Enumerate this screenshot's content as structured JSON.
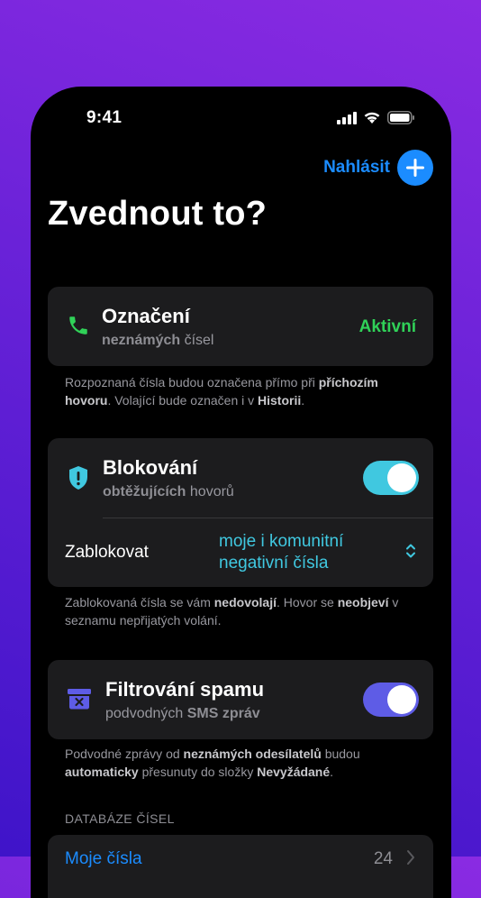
{
  "status": {
    "time": "9:41"
  },
  "header": {
    "report_label": "Nahlásit"
  },
  "title": "Zvednout to?",
  "labeling": {
    "title": "Označení",
    "sub_bold": "neznámých",
    "sub_rest": " čísel",
    "status": "Aktivní",
    "note": [
      {
        "t": "Rozpoznaná čísla budou označena přímo při ",
        "b": false
      },
      {
        "t": "příchozím hovoru",
        "b": true
      },
      {
        "t": ". Volající bude označen i v ",
        "b": false
      },
      {
        "t": "Historii",
        "b": true
      },
      {
        "t": ".",
        "b": false
      }
    ]
  },
  "blocking": {
    "title": "Blokování",
    "sub_bold": "obtěžujících",
    "sub_rest": " hovorů",
    "toggle_on": true,
    "block_label": "Zablokovat",
    "block_value_line1": "moje i komunitní",
    "block_value_line2": "negativní čísla",
    "note": [
      {
        "t": "Zablokovaná čísla se vám ",
        "b": false
      },
      {
        "t": "nedovolají",
        "b": true
      },
      {
        "t": ". Hovor se ",
        "b": false
      },
      {
        "t": "neobjeví",
        "b": true
      },
      {
        "t": " v seznamu nepřijatých volání.",
        "b": false
      }
    ]
  },
  "spam": {
    "title": "Filtrování spamu",
    "sub_rest": "podvodných ",
    "sub_bold": "SMS zpráv",
    "toggle_on": true,
    "note": [
      {
        "t": "Podvodné zprávy od ",
        "b": false
      },
      {
        "t": "neznámých odesílatelů",
        "b": true
      },
      {
        "t": " budou ",
        "b": false
      },
      {
        "t": "automaticky",
        "b": true
      },
      {
        "t": " přesunuty do složky ",
        "b": false
      },
      {
        "t": "Nevyžádané",
        "b": true
      },
      {
        "t": ".",
        "b": false
      }
    ]
  },
  "database": {
    "header": "DATABÁZE ČÍSEL",
    "row_label": "Moje čísla",
    "row_count": "24"
  },
  "colors": {
    "accent_blue": "#1b8cff",
    "green": "#30d158",
    "teal": "#40c8e0",
    "purple": "#5e5ce6"
  }
}
